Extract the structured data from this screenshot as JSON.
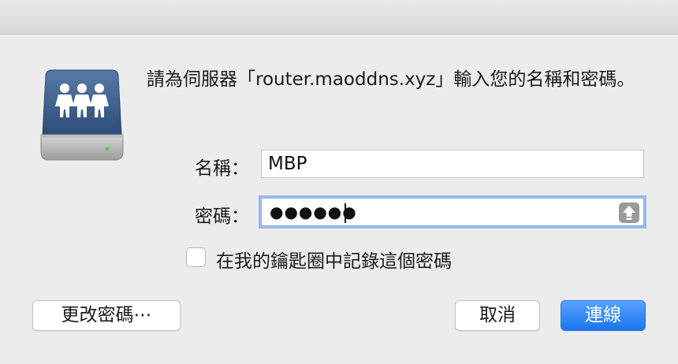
{
  "dialog": {
    "prompt": "請為伺服器「router.maoddns.xyz」輸入您的名稱和密碼。",
    "name_label": "名稱：",
    "name_value": "MBP",
    "password_label": "密碼：",
    "password_masked": "●●●●●●",
    "keychain_label": "在我的鑰匙圈中記錄這個密碼",
    "keychain_checked": false,
    "change_password_label": "更改密碼⋯",
    "cancel_label": "取消",
    "connect_label": "連線",
    "icons": {
      "server": "shared-server-icon",
      "capslock": "caps-lock-icon"
    },
    "colors": {
      "accent": "#1876f2",
      "focus_ring": "#9ab9ed",
      "icon_face": "#3f5f8c"
    }
  }
}
